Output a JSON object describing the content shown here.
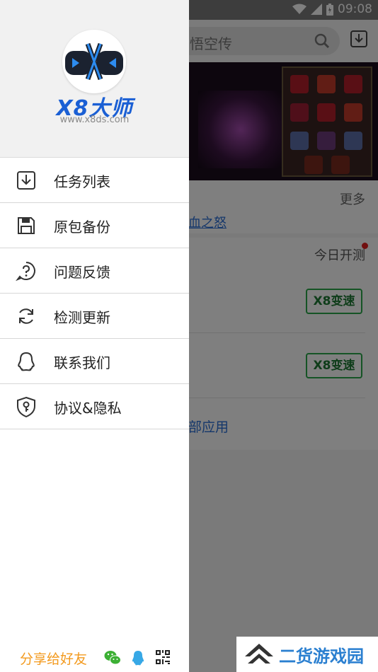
{
  "status_bar": {
    "time": "09:08"
  },
  "app": {
    "search_text": "悟空传",
    "more_label": "更多",
    "game_link": "血之怒",
    "today_test": "今日开测",
    "speed_button_1": "X8变速",
    "speed_button_2": "X8变速",
    "all_apps": "部应用"
  },
  "drawer": {
    "brand_title": "X8大师",
    "brand_url": "www.x8ds.com",
    "menu": [
      {
        "label": "任务列表",
        "icon": "download-icon"
      },
      {
        "label": "原包备份",
        "icon": "save-icon"
      },
      {
        "label": "问题反馈",
        "icon": "question-icon"
      },
      {
        "label": "检测更新",
        "icon": "refresh-icon"
      },
      {
        "label": "联系我们",
        "icon": "qq-icon"
      },
      {
        "label": "协议&隐私",
        "icon": "shield-lock-icon"
      }
    ],
    "share_label": "分享给好友"
  },
  "watermark": {
    "text": "二货游戏园"
  },
  "colors": {
    "brand_blue": "#1a5fd4",
    "share_orange": "#f39a1e",
    "speed_green": "#2aa84a",
    "wechat_green": "#3cb034",
    "qq_blue": "#37a8e6"
  }
}
